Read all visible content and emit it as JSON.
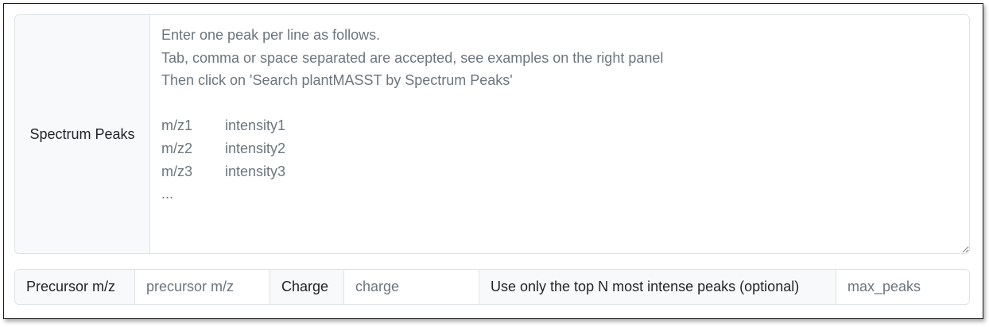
{
  "spectrum": {
    "label": "Spectrum Peaks",
    "placeholder": "Enter one peak per line as follows.\nTab, comma or space separated are accepted, see examples on the right panel\nThen click on 'Search plantMASST by Spectrum Peaks'\n\nm/z1\tintensity1\nm/z2\tintensity2\nm/z3\tintensity3\n..."
  },
  "params": {
    "precursor_label": "Precursor m/z",
    "precursor_placeholder": "precursor m/z",
    "charge_label": "Charge",
    "charge_placeholder": "charge",
    "topn_label": "Use only the top N most intense peaks (optional)",
    "maxpeaks_placeholder": "max_peaks"
  }
}
